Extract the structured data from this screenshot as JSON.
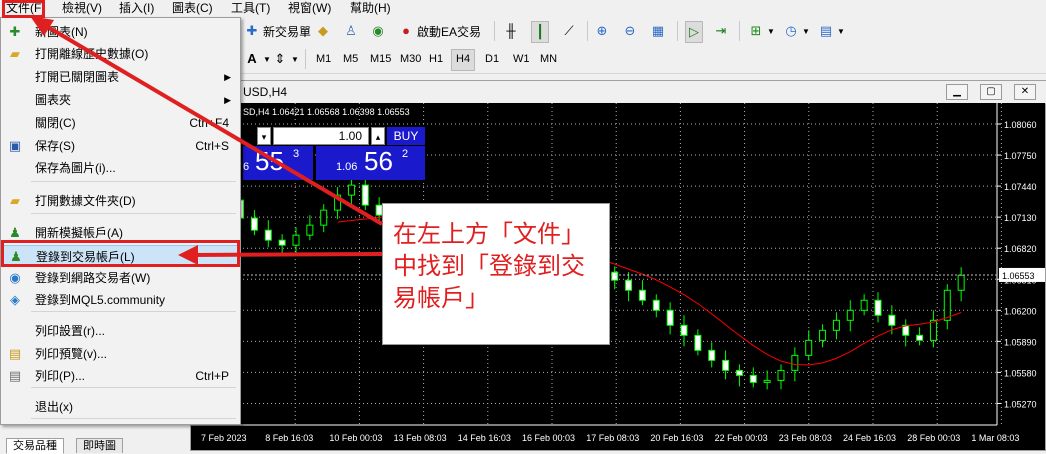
{
  "menubar": {
    "items": [
      "文件(F)",
      "檢視(V)",
      "插入(I)",
      "圖表(C)",
      "工具(T)",
      "視窗(W)",
      "幫助(H)"
    ]
  },
  "toolbar": {
    "new_order": "新交易單",
    "ea_trading": "啟動EA交易",
    "timeframes": [
      "M1",
      "M5",
      "M15",
      "M30",
      "H1",
      "H4",
      "D1",
      "W1",
      "MN"
    ],
    "active_timeframe": "H4"
  },
  "file_menu": {
    "items": [
      {
        "icon": "new-chart-icon",
        "label": "新圖表(N)",
        "shortcut": "",
        "arrow": false
      },
      {
        "icon": "open-folder-icon",
        "label": "打開離線歷史數據(O)",
        "shortcut": "",
        "arrow": false
      },
      {
        "icon": "",
        "label": "打開已關閉圖表",
        "shortcut": "",
        "arrow": true
      },
      {
        "icon": "",
        "label": "圖表夾",
        "shortcut": "",
        "arrow": true
      },
      {
        "icon": "",
        "label": "關閉(C)",
        "shortcut": "Ctrl+F4",
        "arrow": false
      },
      {
        "icon": "save-icon",
        "label": "保存(S)",
        "shortcut": "Ctrl+S",
        "arrow": false
      },
      {
        "icon": "",
        "label": "保存為圖片(i)...",
        "shortcut": "",
        "arrow": false
      },
      {
        "icon": "data-folder-icon",
        "label": "打開數據文件夾(D)",
        "shortcut": "",
        "arrow": false
      },
      {
        "icon": "demo-account-icon",
        "label": "開新模擬帳戶(A)",
        "shortcut": "",
        "arrow": false
      },
      {
        "icon": "login-account-icon",
        "label": "登錄到交易帳戶(L)",
        "shortcut": "",
        "arrow": false
      },
      {
        "icon": "web-trader-icon",
        "label": "登錄到網路交易者(W)",
        "shortcut": "",
        "arrow": false
      },
      {
        "icon": "mql5-icon",
        "label": "登錄到MQL5.community",
        "shortcut": "",
        "arrow": false
      },
      {
        "icon": "",
        "label": "列印設置(r)...",
        "shortcut": "",
        "arrow": false
      },
      {
        "icon": "print-preview-icon",
        "label": "列印預覽(v)...",
        "shortcut": "",
        "arrow": false
      },
      {
        "icon": "print-icon",
        "label": "列印(P)...",
        "shortcut": "Ctrl+P",
        "arrow": false
      },
      {
        "icon": "",
        "label": "退出(x)",
        "shortcut": "",
        "arrow": false
      }
    ],
    "highlighted_index": 9
  },
  "chart": {
    "title_fragment": "USD,H4",
    "ohlc_line": "SD,H4  1.06421 1.06568 1.06398 1.06553",
    "trade_panel": {
      "lot": "1.00",
      "buy_label": "BUY",
      "sell_price_small": "6",
      "sell_price_big": "55",
      "sell_price_sup": "3",
      "buy_price_small": "1.06",
      "buy_price_big": "56",
      "buy_price_sup": "2"
    },
    "price_labels": [
      "1.08060",
      "1.07750",
      "1.07440",
      "1.07130",
      "1.06820",
      "1.06510",
      "1.06200",
      "1.05890",
      "1.05580",
      "1.05270"
    ],
    "current_price": "1.06553",
    "time_labels": [
      "7 Feb 2023",
      "8 Feb 16:03",
      "10 Feb 00:03",
      "13 Feb 08:03",
      "14 Feb 16:03",
      "16 Feb 00:03",
      "17 Feb 08:03",
      "20 Feb 16:03",
      "22 Feb 00:03",
      "23 Feb 08:03",
      "24 Feb 16:03",
      "28 Feb 00:03",
      "1 Mar 08:03"
    ]
  },
  "bottom_tabs": [
    "交易品種",
    "即時圖"
  ],
  "annotation": {
    "text": "在左上方「文件」中找到「登錄到交易帳戶」",
    "color": "#e02020"
  },
  "colors": {
    "chart_bg": "#000000",
    "candle": "#00ff00",
    "ma_line": "#ff0000",
    "grid": "#c0c0c0",
    "highlight": "#cce4f7",
    "buy_panel": "#1a1acc"
  }
}
